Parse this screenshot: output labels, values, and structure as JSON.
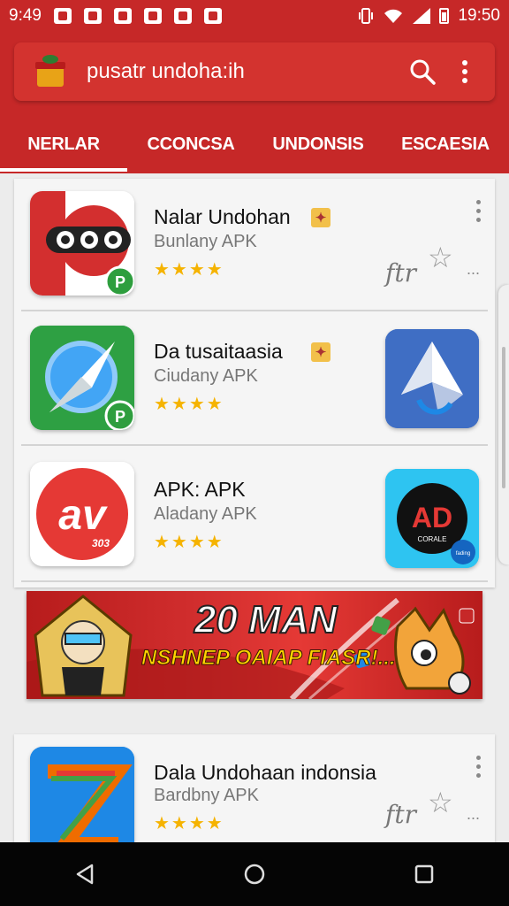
{
  "status_bar": {
    "time_left": "9:49",
    "time_right": "19:50"
  },
  "search": {
    "query": "pusatr undoha:ih"
  },
  "tabs": [
    {
      "label": "NERLAR",
      "active": true
    },
    {
      "label": "CCONCSA",
      "active": false
    },
    {
      "label": "UNDONSIS",
      "active": false
    },
    {
      "label": "ESCAESIA",
      "active": false
    }
  ],
  "apps": [
    {
      "title": "Nalar Undohan",
      "subtitle": "Bunlany APK",
      "stars": "★★★★",
      "signature": "ftr",
      "ellipsis": "..."
    },
    {
      "title": "Da tusaitaasia",
      "subtitle": "Ciudany APK",
      "stars": "★★★★"
    },
    {
      "title": "APK: APK",
      "subtitle": "Aladany APK",
      "stars": "★★★★",
      "icon_text": "av",
      "icon_subtext": "303",
      "side_icon_text": "AD",
      "side_icon_sub": "CORALE",
      "side_badge": "fading"
    },
    {
      "title": "Dala Undohaan indonsia",
      "subtitle": "Bardbny APK",
      "stars": "★★★★",
      "signature": "ftr",
      "ellipsis": "..."
    }
  ],
  "banner": {
    "line1": "20 MAN",
    "line2": "NSHNEP OAIAP FIASR!..."
  },
  "colors": {
    "brand_red": "#c62828",
    "star_gold": "#f5b301",
    "nav_black": "#050505"
  }
}
